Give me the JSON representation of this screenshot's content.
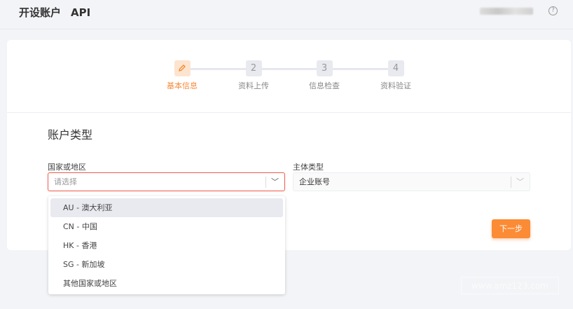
{
  "header": {
    "title": "开设账户",
    "subtitle": "API",
    "help_icon": "?"
  },
  "steps": [
    {
      "label": "基本信息",
      "icon": "pencil-icon",
      "active": true
    },
    {
      "label": "资料上传",
      "number": "2"
    },
    {
      "label": "信息检查",
      "number": "3"
    },
    {
      "label": "资料验证",
      "number": "4"
    }
  ],
  "section_title": "账户类型",
  "country": {
    "label": "国家或地区",
    "placeholder": "请选择",
    "options": [
      "AU - 澳大利亚",
      "CN - 中国",
      "HK - 香港",
      "SG - 新加坡",
      "其他国家或地区"
    ]
  },
  "entity": {
    "label": "主体类型",
    "value": "企业账号"
  },
  "next_button": "下一步",
  "watermark": "www.amz123.com"
}
